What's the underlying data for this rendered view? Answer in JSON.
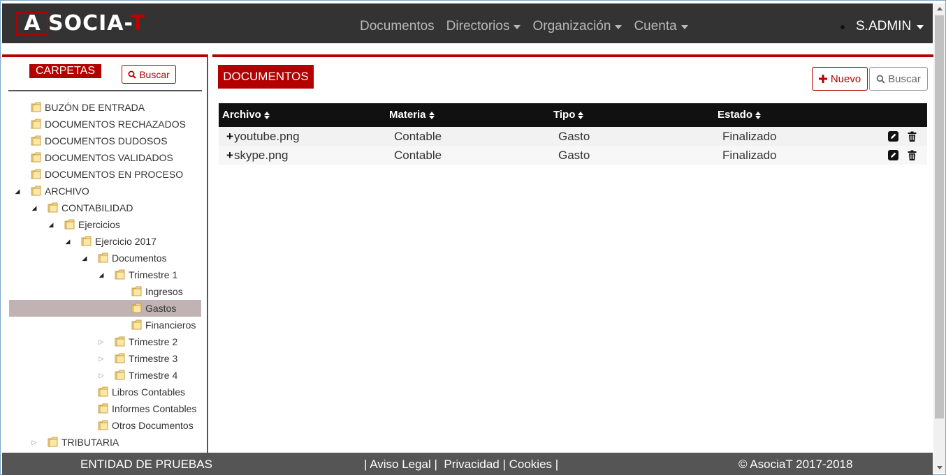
{
  "brand": {
    "logo_box_letter": "A",
    "logo_text_main": "SOCIA-",
    "logo_text_accent": "T"
  },
  "nav": {
    "items": [
      {
        "label": "Documentos",
        "dropdown": false
      },
      {
        "label": "Directorios",
        "dropdown": true
      },
      {
        "label": "Organización",
        "dropdown": true
      },
      {
        "label": "Cuenta",
        "dropdown": true
      }
    ],
    "user": "S.ADMIN"
  },
  "sidebar": {
    "title": "CARPETAS",
    "search_label": "Buscar",
    "tree": [
      {
        "label": "BUZÓN DE ENTRADA",
        "level": 1,
        "toggle": "none"
      },
      {
        "label": "DOCUMENTOS RECHAZADOS",
        "level": 1,
        "toggle": "none"
      },
      {
        "label": "DOCUMENTOS DUDOSOS",
        "level": 1,
        "toggle": "none"
      },
      {
        "label": "DOCUMENTOS VALIDADOS",
        "level": 1,
        "toggle": "none"
      },
      {
        "label": "DOCUMENTOS EN PROCESO",
        "level": 1,
        "toggle": "none"
      },
      {
        "label": "ARCHIVO",
        "level": 1,
        "toggle": "expanded"
      },
      {
        "label": "CONTABILIDAD",
        "level": 2,
        "toggle": "expanded"
      },
      {
        "label": "Ejercicios",
        "level": 3,
        "toggle": "expanded"
      },
      {
        "label": "Ejercicio 2017",
        "level": 4,
        "toggle": "expanded"
      },
      {
        "label": "Documentos",
        "level": 5,
        "toggle": "expanded"
      },
      {
        "label": "Trimestre 1",
        "level": 6,
        "toggle": "expanded"
      },
      {
        "label": "Ingresos",
        "level": 7,
        "toggle": "none"
      },
      {
        "label": "Gastos",
        "level": 7,
        "toggle": "none",
        "selected": true
      },
      {
        "label": "Financieros",
        "level": 7,
        "toggle": "none"
      },
      {
        "label": "Trimestre 2",
        "level": 6,
        "toggle": "collapsed"
      },
      {
        "label": "Trimestre 3",
        "level": 6,
        "toggle": "collapsed"
      },
      {
        "label": "Trimestre 4",
        "level": 6,
        "toggle": "collapsed"
      },
      {
        "label": "Libros Contables",
        "level": 5,
        "toggle": "none"
      },
      {
        "label": "Informes Contables",
        "level": 5,
        "toggle": "none"
      },
      {
        "label": "Otros Documentos",
        "level": 5,
        "toggle": "none"
      },
      {
        "label": "TRIBUTARIA",
        "level": 2,
        "toggle": "collapsed"
      }
    ]
  },
  "main": {
    "title": "DOCUMENTOS",
    "new_label": "Nuevo",
    "search_label": "Buscar",
    "columns": [
      "Archivo",
      "Materia",
      "Tipo",
      "Estado"
    ],
    "rows": [
      {
        "archivo": "youtube.png",
        "materia": "Contable",
        "tipo": "Gasto",
        "estado": "Finalizado"
      },
      {
        "archivo": "skype.png",
        "materia": "Contable",
        "tipo": "Gasto",
        "estado": "Finalizado"
      }
    ]
  },
  "footer": {
    "entity": "ENTIDAD DE PRUEBAS",
    "links": "| Aviso Legal |  Privacidad | Cookies |",
    "copyright": "© AsociaT 2017-2018"
  },
  "colors": {
    "accent": "#b30000",
    "navbar_bg": "#333333",
    "footer_bg": "#555555",
    "selected_row": "#c1b3b3"
  }
}
